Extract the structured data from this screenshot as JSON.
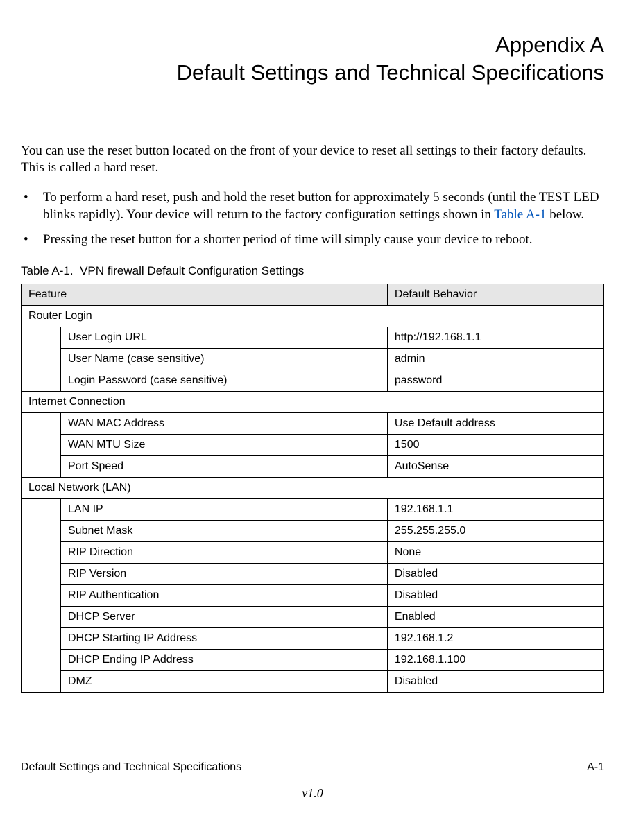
{
  "heading": {
    "line1": "Appendix A",
    "line2": "Default Settings and Technical Specifications"
  },
  "intro": "You can use the reset button located on the front of your device to reset all settings to their factory defaults. This is called a hard reset.",
  "bullets": [
    {
      "pre": "To perform a hard reset, push and hold the reset button for approximately 5 seconds (until the TEST LED blinks rapidly). Your device will return to the factory configuration settings shown in ",
      "link": "Table A-1",
      "post": " below."
    },
    {
      "pre": "Pressing the reset button for a shorter period of time will simply cause your device to reboot.",
      "link": "",
      "post": ""
    }
  ],
  "table": {
    "caption_prefix": "Table A-1.",
    "caption_text": "VPN firewall Default Configuration Settings",
    "header": {
      "feature": "Feature",
      "behavior": "Default Behavior"
    },
    "sections": [
      {
        "title": "Router Login",
        "rows": [
          {
            "feature": "User Login URL",
            "value": "http://192.168.1.1"
          },
          {
            "feature": "User Name (case sensitive)",
            "value": "admin"
          },
          {
            "feature": "Login Password (case sensitive)",
            "value": "password"
          }
        ]
      },
      {
        "title": "Internet Connection",
        "rows": [
          {
            "feature": "WAN MAC Address",
            "value": "Use Default address"
          },
          {
            "feature": "WAN MTU Size",
            "value": "1500"
          },
          {
            "feature": "Port Speed",
            "value": "AutoSense"
          }
        ]
      },
      {
        "title": "Local Network (LAN)",
        "rows": [
          {
            "feature": "LAN IP",
            "value": "192.168.1.1"
          },
          {
            "feature": "Subnet Mask",
            "value": "255.255.255.0"
          },
          {
            "feature": "RIP Direction",
            "value": "None"
          },
          {
            "feature": "RIP Version",
            "value": "Disabled"
          },
          {
            "feature": "RIP Authentication",
            "value": "Disabled"
          },
          {
            "feature": "DHCP Server",
            "value": "Enabled"
          },
          {
            "feature": "DHCP Starting IP Address",
            "value": "192.168.1.2"
          },
          {
            "feature": "DHCP Ending IP Address",
            "value": "192.168.1.100"
          },
          {
            "feature": "DMZ",
            "value": "Disabled"
          }
        ]
      }
    ]
  },
  "footer": {
    "left": "Default Settings and Technical Specifications",
    "right": "A-1",
    "version": "v1.0"
  }
}
